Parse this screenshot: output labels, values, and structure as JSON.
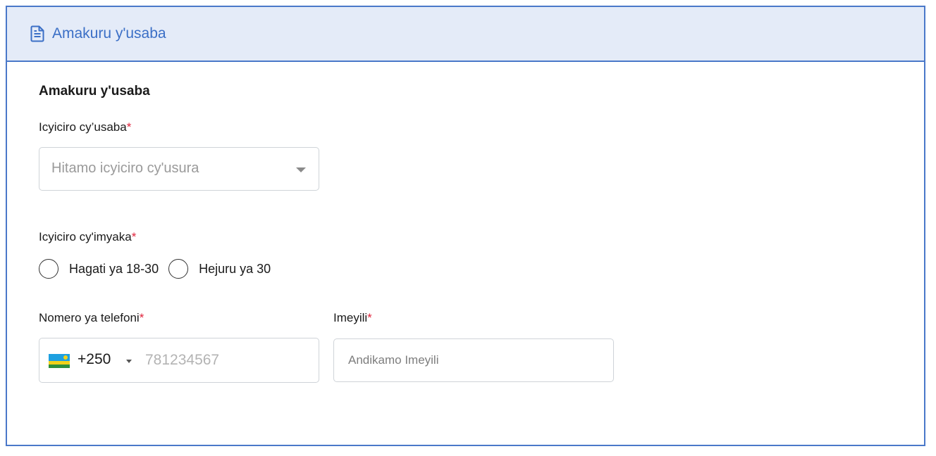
{
  "header": {
    "title": "Amakuru y'usaba",
    "icon": "document-icon",
    "accent_color": "#3b6fc6",
    "background_color": "#e4ebf8"
  },
  "form": {
    "section_title": "Amakuru y'usaba",
    "category": {
      "label": "Icyiciro cy’usaba",
      "required_mark": "*",
      "placeholder": "Hitamo icyiciro cy'usura"
    },
    "age_group": {
      "label": "Icyiciro cy'imyaka",
      "required_mark": "*",
      "options": [
        {
          "label": "Hagati ya 18-30"
        },
        {
          "label": "Hejuru ya 30"
        }
      ]
    },
    "phone": {
      "label": "Nomero ya telefoni",
      "required_mark": "*",
      "country_flag": "rwanda-flag-icon",
      "dial_code": "+250",
      "placeholder": "781234567"
    },
    "email": {
      "label": "Imeyili",
      "required_mark": "*",
      "placeholder": "Andikamo Imeyili"
    },
    "required_color": "#e0233b"
  }
}
